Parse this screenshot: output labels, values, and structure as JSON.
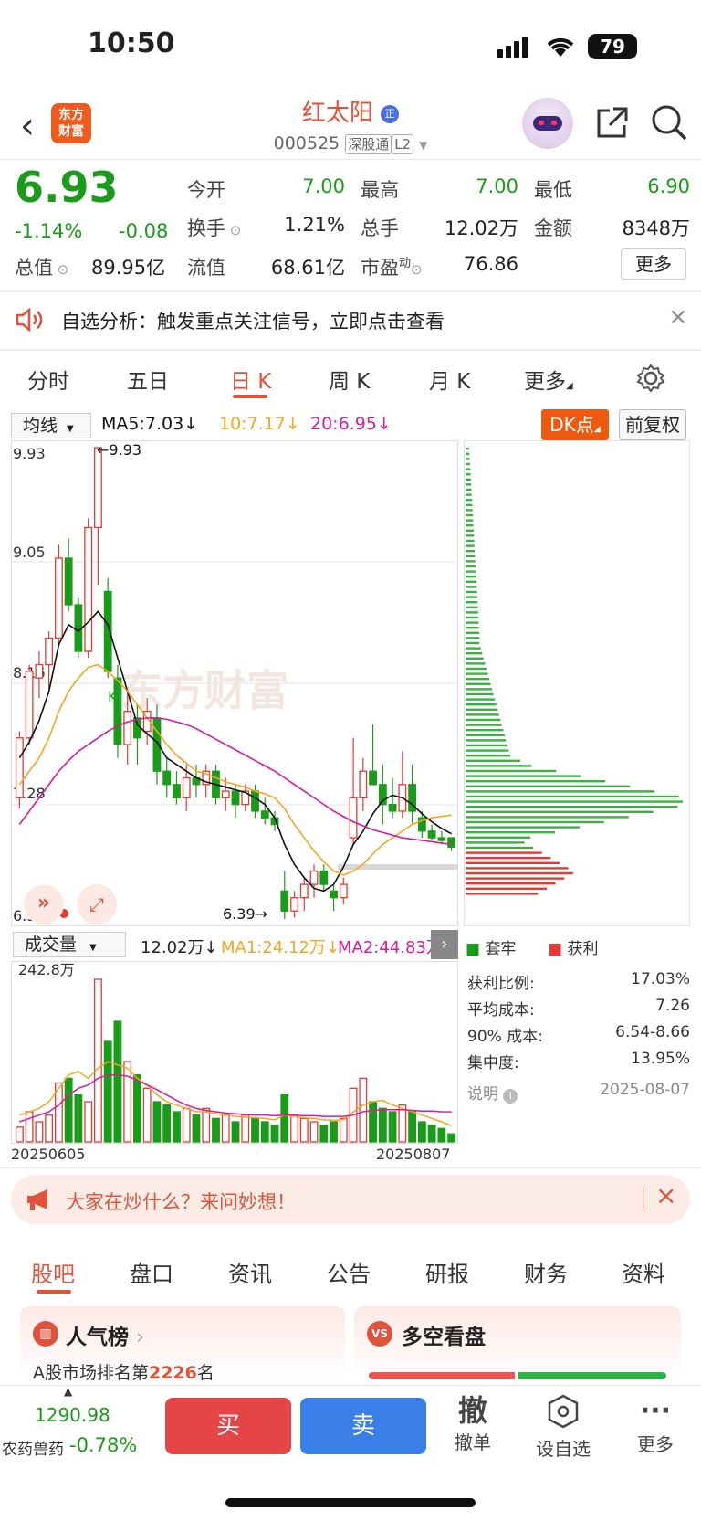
{
  "status_bar": {
    "time": "10:50",
    "battery": "79"
  },
  "header": {
    "logo_text": "东方\n财富",
    "stock_name": "红太阳",
    "name_badge": "正",
    "stock_code": "000525",
    "tag_connect": "深股通",
    "tag_level": "L2"
  },
  "quote": {
    "price": "6.93",
    "change_pct": "-1.14%",
    "change": "-0.08",
    "open_label": "今开",
    "open": "7.00",
    "high_label": "最高",
    "high": "7.00",
    "low_label": "最低",
    "low": "6.90",
    "turnover_label": "换手",
    "turnover": "1.21%",
    "volume_label": "总手",
    "volume": "12.02万",
    "amount_label": "金额",
    "amount": "8348万",
    "mktcap_label": "总值",
    "mktcap": "89.95亿",
    "float_label": "流值",
    "float": "68.61亿",
    "pe_label": "市盈",
    "pe_sup": "动",
    "pe": "76.86",
    "more_label": "更多"
  },
  "notice": {
    "text": "自选分析：触发重点关注信号，立即点击查看"
  },
  "kline_tabs": [
    {
      "label": "分时"
    },
    {
      "label": "五日"
    },
    {
      "label": "日 K"
    },
    {
      "label": "周 K"
    },
    {
      "label": "月 K"
    },
    {
      "label": "更多"
    }
  ],
  "ma_bar": {
    "select": "均线",
    "ma5": "MA5:7.03",
    "ma10": "10:7.17",
    "ma20": "20:6.95",
    "dk": "DK点",
    "fq": "前复权"
  },
  "price_axis": [
    "9.93",
    "9.05",
    "8.16",
    "7.28",
    "6.39"
  ],
  "annotations": {
    "high": "←9.93",
    "low": "6.39→",
    "k_mark": "K"
  },
  "watermark": "东方财富",
  "volume_bar": {
    "select": "成交量",
    "vol": "12.02万",
    "ma1": "MA1:24.12万",
    "ma2": "MA2:44.83万",
    "max": "242.8万",
    "date_start": "20250605",
    "date_end": "20250807"
  },
  "chips": {
    "legend_trapped": "套牢",
    "legend_profit": "获利",
    "rows": [
      {
        "label": "获利比例:",
        "value": "17.03%"
      },
      {
        "label": "平均成本:",
        "value": "7.26"
      },
      {
        "label": "90% 成本:",
        "value": "6.54-8.66"
      },
      {
        "label": "集中度:",
        "value": "13.95%"
      }
    ],
    "note_label": "说明",
    "date": "2025-08-07"
  },
  "banner": {
    "text": "大家在炒什么？来问妙想！"
  },
  "bottom_tabs": [
    {
      "label": "股吧"
    },
    {
      "label": "盘口"
    },
    {
      "label": "资讯"
    },
    {
      "label": "公告"
    },
    {
      "label": "研报"
    },
    {
      "label": "财务"
    },
    {
      "label": "资料"
    }
  ],
  "cards": {
    "popular_title": "人气榜",
    "popular_rank_prefix": "A股市场排名第",
    "popular_rank": "2226",
    "popular_rank_suffix": "名",
    "duokong_title": "多空看盘"
  },
  "bottom_bar": {
    "index_value": "1290.98",
    "index_name": "农药兽药",
    "index_change": "-0.78%",
    "buy": "买",
    "sell": "卖",
    "cancel_char": "撤",
    "cancel_label": "撤单",
    "watch_label": "设自选",
    "more_label": "更多"
  },
  "colors": {
    "up": "#e53935",
    "down": "#1a9b1a",
    "accent": "#e0523a",
    "ma5": "#111111",
    "ma10": "#f5a623",
    "ma20": "#d81b9a"
  },
  "chart_data": {
    "type": "candlestick",
    "ylim": [
      6.39,
      9.93
    ],
    "candles": [
      [
        7.3,
        7.8,
        7.22,
        7.75
      ],
      [
        7.75,
        8.3,
        7.7,
        8.25
      ],
      [
        8.2,
        8.4,
        8.05,
        8.3
      ],
      [
        8.3,
        8.55,
        8.1,
        8.5
      ],
      [
        8.5,
        9.2,
        8.45,
        9.1
      ],
      [
        9.1,
        9.25,
        8.7,
        8.75
      ],
      [
        8.75,
        8.8,
        8.35,
        8.4
      ],
      [
        8.4,
        9.4,
        8.35,
        9.33
      ],
      [
        9.33,
        9.93,
        8.9,
        9.93
      ],
      [
        8.85,
        8.95,
        8.2,
        8.25
      ],
      [
        8.2,
        8.3,
        7.6,
        7.7
      ],
      [
        7.7,
        8.1,
        7.55,
        7.95
      ],
      [
        7.9,
        8.0,
        7.55,
        7.75
      ],
      [
        7.8,
        8.05,
        7.7,
        7.95
      ],
      [
        7.9,
        8.0,
        7.4,
        7.5
      ],
      [
        7.5,
        7.6,
        7.3,
        7.4
      ],
      [
        7.4,
        7.5,
        7.25,
        7.3
      ],
      [
        7.3,
        7.55,
        7.2,
        7.45
      ],
      [
        7.45,
        7.55,
        7.3,
        7.4
      ],
      [
        7.4,
        7.55,
        7.3,
        7.5
      ],
      [
        7.5,
        7.55,
        7.25,
        7.3
      ],
      [
        7.3,
        7.45,
        7.2,
        7.35
      ],
      [
        7.35,
        7.4,
        7.15,
        7.25
      ],
      [
        7.25,
        7.4,
        7.2,
        7.35
      ],
      [
        7.35,
        7.4,
        7.15,
        7.2
      ],
      [
        7.2,
        7.3,
        7.1,
        7.15
      ],
      [
        7.15,
        7.2,
        7.05,
        7.1
      ],
      [
        6.6,
        6.75,
        6.39,
        6.45
      ],
      [
        6.45,
        6.6,
        6.4,
        6.55
      ],
      [
        6.55,
        6.7,
        6.45,
        6.65
      ],
      [
        6.65,
        6.8,
        6.55,
        6.75
      ],
      [
        6.75,
        6.8,
        6.6,
        6.65
      ],
      [
        6.6,
        6.65,
        6.45,
        6.55
      ],
      [
        6.55,
        6.7,
        6.5,
        6.65
      ],
      [
        7.0,
        7.75,
        6.95,
        7.3
      ],
      [
        7.3,
        7.6,
        7.2,
        7.5
      ],
      [
        7.5,
        7.85,
        7.4,
        7.4
      ],
      [
        7.4,
        7.55,
        7.1,
        7.25
      ],
      [
        7.25,
        7.45,
        7.15,
        7.2
      ],
      [
        7.2,
        7.65,
        7.15,
        7.4
      ],
      [
        7.4,
        7.55,
        7.1,
        7.2
      ],
      [
        7.15,
        7.2,
        7.0,
        7.05
      ],
      [
        7.05,
        7.1,
        6.98,
        7.0
      ],
      [
        7.0,
        7.05,
        6.95,
        6.98
      ],
      [
        7.0,
        7.0,
        6.9,
        6.93
      ]
    ],
    "ma5": [
      7.6,
      7.72,
      7.88,
      8.1,
      8.45,
      8.6,
      8.55,
      8.62,
      8.7,
      8.6,
      8.35,
      8.1,
      7.85,
      7.78,
      7.72,
      7.6,
      7.55,
      7.5,
      7.45,
      7.42,
      7.4,
      7.38,
      7.36,
      7.34,
      7.3,
      7.25,
      7.15,
      6.95,
      6.8,
      6.7,
      6.62,
      6.6,
      6.65,
      6.78,
      6.95,
      7.05,
      7.18,
      7.28,
      7.32,
      7.3,
      7.25,
      7.18,
      7.12,
      7.07,
      7.03
    ],
    "ma10": [
      7.4,
      7.5,
      7.6,
      7.75,
      7.95,
      8.1,
      8.2,
      8.28,
      8.3,
      8.25,
      8.18,
      8.1,
      8.0,
      7.9,
      7.8,
      7.7,
      7.62,
      7.56,
      7.5,
      7.48,
      7.45,
      7.42,
      7.4,
      7.38,
      7.35,
      7.33,
      7.3,
      7.22,
      7.1,
      7.0,
      6.9,
      6.82,
      6.75,
      6.72,
      6.75,
      6.8,
      6.88,
      6.95,
      7.0,
      7.05,
      7.1,
      7.13,
      7.15,
      7.16,
      7.17
    ],
    "ma20": [
      7.1,
      7.2,
      7.3,
      7.4,
      7.5,
      7.58,
      7.65,
      7.7,
      7.75,
      7.8,
      7.84,
      7.87,
      7.89,
      7.9,
      7.9,
      7.89,
      7.87,
      7.85,
      7.82,
      7.78,
      7.74,
      7.7,
      7.66,
      7.62,
      7.58,
      7.54,
      7.5,
      7.45,
      7.4,
      7.35,
      7.3,
      7.25,
      7.2,
      7.16,
      7.12,
      7.09,
      7.06,
      7.04,
      7.02,
      7.0,
      6.99,
      6.98,
      6.97,
      6.96,
      6.95
    ],
    "volume_max": 242.8,
    "volumes": [
      22,
      45,
      30,
      40,
      88,
      95,
      70,
      60,
      242.8,
      150,
      180,
      120,
      100,
      80,
      60,
      55,
      45,
      50,
      40,
      50,
      35,
      40,
      30,
      40,
      35,
      30,
      25,
      70,
      40,
      35,
      30,
      25,
      30,
      35,
      80,
      95,
      60,
      50,
      45,
      55,
      45,
      30,
      25,
      20,
      12.02
    ],
    "vol_ma1": [
      40,
      45,
      50,
      60,
      80,
      100,
      105,
      95,
      110,
      120,
      115,
      110,
      95,
      85,
      70,
      60,
      55,
      50,
      45,
      45,
      42,
      40,
      38,
      37,
      36,
      35,
      33,
      40,
      38,
      36,
      35,
      33,
      32,
      33,
      45,
      55,
      60,
      62,
      55,
      50,
      45,
      40,
      35,
      30,
      24.12
    ],
    "vol_ma2": [
      30,
      35,
      40,
      45,
      55,
      70,
      80,
      85,
      95,
      100,
      100,
      98,
      92,
      85,
      78,
      70,
      62,
      55,
      50,
      47,
      45,
      43,
      42,
      41,
      40,
      40,
      39,
      40,
      40,
      39,
      39,
      38,
      38,
      38,
      40,
      45,
      47,
      48,
      48,
      48,
      47,
      46,
      46,
      45,
      44.83
    ]
  }
}
